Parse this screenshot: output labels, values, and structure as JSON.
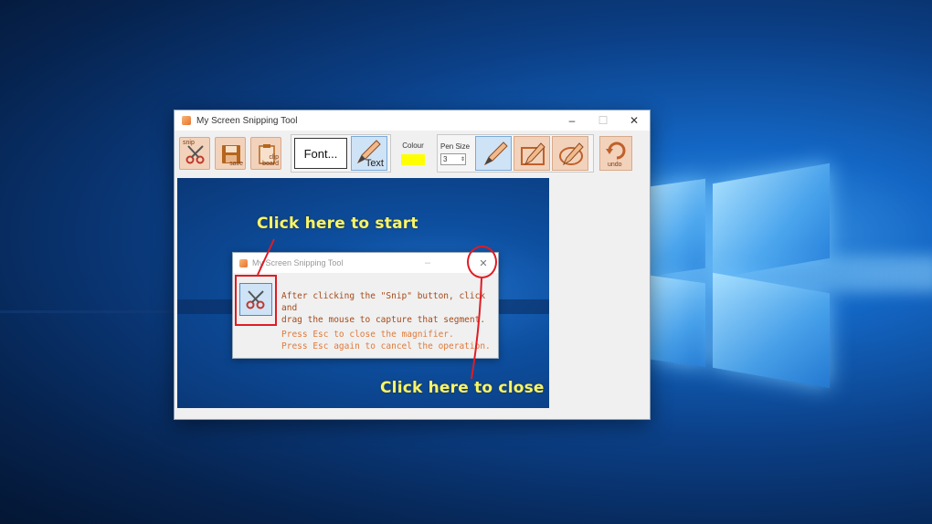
{
  "window": {
    "title": "My Screen Snipping Tool",
    "min_symbol": "–",
    "max_symbol": "☐",
    "close_symbol": "✕"
  },
  "toolbar": {
    "snip_label": "snip",
    "save_label": "save",
    "clip_label_1": "clip",
    "clip_label_2": "board",
    "font_label": "Font...",
    "text_label": "Text",
    "colour_label": "Colour",
    "colour_value": "#ffff00",
    "pen_size_label": "Pen Size",
    "pen_size_value": "3",
    "undo_label": "undo"
  },
  "dialog": {
    "title": "My Screen Snipping Tool",
    "min_symbol": "–",
    "close_symbol": "✕",
    "message_line1": "After clicking the \"Snip\" button, click and",
    "message_line2": "drag the mouse to capture that segment.",
    "hint_line1": "Press Esc to close the magnifier.",
    "hint_line2": "Press Esc again to cancel the operation."
  },
  "annotations": {
    "start_text": "Click here to start",
    "close_text": "Click here to close",
    "color": "#e01b24"
  },
  "icons": [
    "scissors-icon",
    "floppy-disk-icon",
    "clipboard-icon",
    "pencil-icon",
    "rectangle-pen-icon",
    "ellipse-pen-icon",
    "undo-arrow-icon"
  ]
}
